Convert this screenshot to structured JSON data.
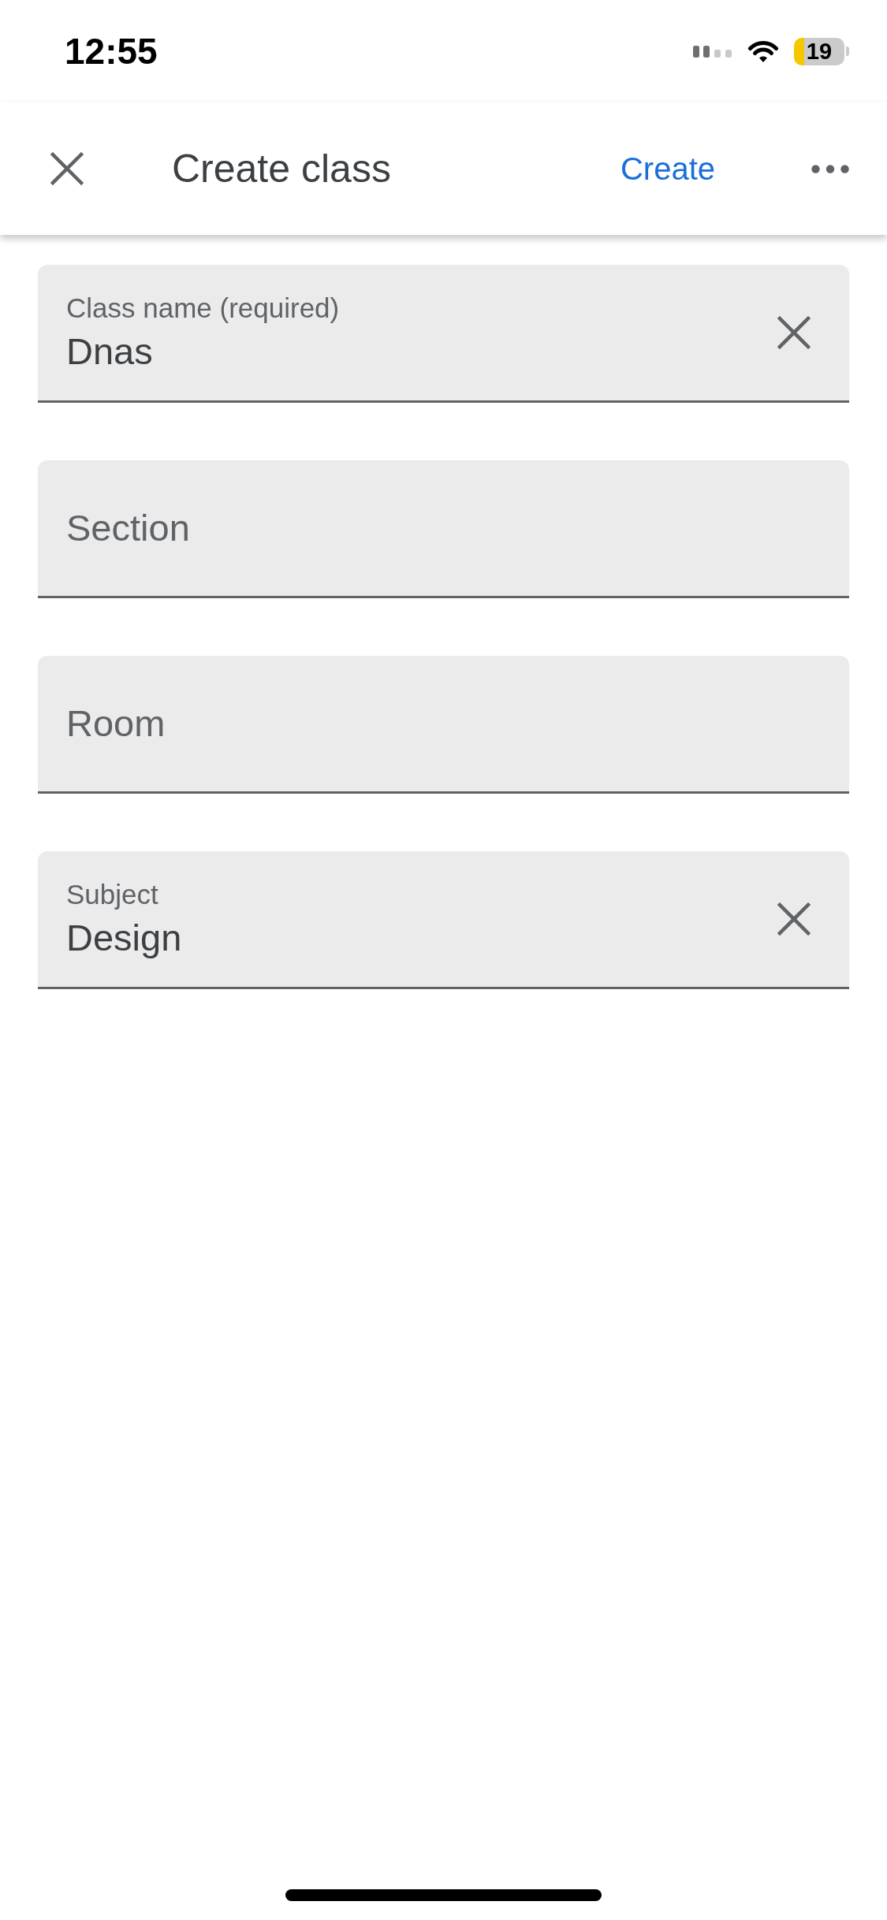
{
  "status_bar": {
    "time": "12:55",
    "battery": "19"
  },
  "header": {
    "title": "Create class",
    "action": "Create"
  },
  "fields": [
    {
      "label": "Class name (required)",
      "value": "Dnas"
    },
    {
      "placeholder": "Section"
    },
    {
      "placeholder": "Room"
    },
    {
      "label": "Subject",
      "value": "Design"
    }
  ]
}
